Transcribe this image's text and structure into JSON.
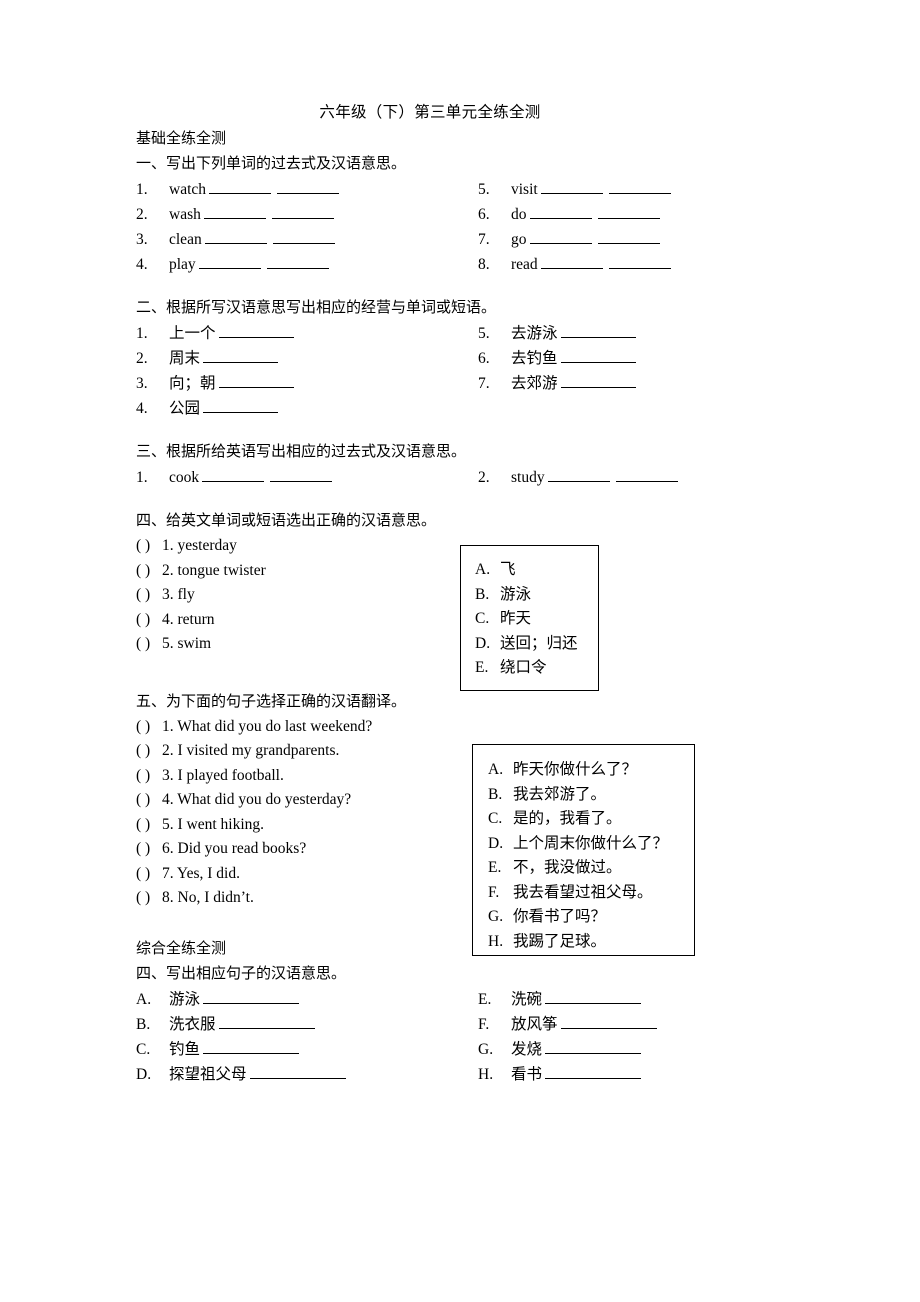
{
  "document": {
    "title": "六年级（下）第三单元全练全测",
    "part_one_label": "基础全练全测",
    "part_two_label": "综合全练全测"
  },
  "section_1": {
    "heading": "一、写出下列单词的过去式及汉语意思。",
    "left": [
      {
        "num": "1.",
        "word": "watch"
      },
      {
        "num": "2.",
        "word": "wash"
      },
      {
        "num": "3.",
        "word": "clean"
      },
      {
        "num": "4.",
        "word": "play"
      }
    ],
    "right": [
      {
        "num": "5.",
        "word": "visit"
      },
      {
        "num": "6.",
        "word": "do"
      },
      {
        "num": "7.",
        "word": "go"
      },
      {
        "num": "8.",
        "word": "read"
      }
    ]
  },
  "section_2": {
    "heading": "二、根据所写汉语意思写出相应的经营与单词或短语。",
    "left": [
      {
        "num": "1.",
        "word": "上一个"
      },
      {
        "num": "2.",
        "word": "周末"
      },
      {
        "num": "3.",
        "word": "向；朝"
      },
      {
        "num": "4.",
        "word": "公园"
      }
    ],
    "right": [
      {
        "num": "5.",
        "word": "去游泳"
      },
      {
        "num": "6.",
        "word": "去钓鱼"
      },
      {
        "num": "7.",
        "word": "去郊游"
      }
    ]
  },
  "section_3": {
    "heading": "三、根据所给英语写出相应的过去式及汉语意思。",
    "left": [
      {
        "num": "1.",
        "word": "cook"
      }
    ],
    "right": [
      {
        "num": "2.",
        "word": "study"
      }
    ]
  },
  "section_4": {
    "heading": "四、给英文单词或短语选出正确的汉语意思。",
    "items": [
      {
        "paren": "(    )",
        "text": "1. yesterday"
      },
      {
        "paren": "(    )",
        "text": "2. tongue twister"
      },
      {
        "paren": "(    )",
        "text": "3. fly"
      },
      {
        "paren": "(    )",
        "text": "4. return"
      },
      {
        "paren": "(    )",
        "text": "5. swim"
      }
    ],
    "options": [
      {
        "letter": "A.",
        "text": "飞"
      },
      {
        "letter": "B.",
        "text": "游泳"
      },
      {
        "letter": "C.",
        "text": "昨天"
      },
      {
        "letter": "D.",
        "text": "送回；归还"
      },
      {
        "letter": "E.",
        "text": "绕口令"
      }
    ]
  },
  "section_5": {
    "heading": "五、为下面的句子选择正确的汉语翻译。",
    "items": [
      {
        "paren": "(    )",
        "text": "1. What did you do last weekend?"
      },
      {
        "paren": "(    )",
        "text": "2. I visited my grandparents."
      },
      {
        "paren": "(    )",
        "text": "3. I played football."
      },
      {
        "paren": "(    )",
        "text": "4. What did you do yesterday?"
      },
      {
        "paren": "(    )",
        "text": "5. I went hiking."
      },
      {
        "paren": "(    )",
        "text": "6. Did you read books?"
      },
      {
        "paren": "(    )",
        "text": "7. Yes, I did."
      },
      {
        "paren": "(    )",
        "text": "8. No, I didn’t."
      }
    ],
    "options": [
      {
        "letter": "A.",
        "text": "昨天你做什么了？"
      },
      {
        "letter": "B.",
        "text": "我去郊游了。"
      },
      {
        "letter": "C.",
        "text": "是的，我看了。"
      },
      {
        "letter": "D.",
        "text": "上个周末你做什么了？"
      },
      {
        "letter": "E.",
        "text": "不，我没做过。"
      },
      {
        "letter": "F.",
        "text": "我去看望过祖父母。"
      },
      {
        "letter": "G.",
        "text": "你看书了吗？"
      },
      {
        "letter": "H.",
        "text": "我踢了足球。"
      }
    ]
  },
  "section_6": {
    "heading": "四、写出相应句子的汉语意思。",
    "left": [
      {
        "num": "A.",
        "word": "游泳"
      },
      {
        "num": "B.",
        "word": "洗衣服"
      },
      {
        "num": "C.",
        "word": "钓鱼"
      },
      {
        "num": "D.",
        "word": "探望祖父母"
      }
    ],
    "right": [
      {
        "num": "E.",
        "word": "洗碗"
      },
      {
        "num": "F.",
        "word": "放风筝"
      },
      {
        "num": "G.",
        "word": "发烧"
      },
      {
        "num": "H.",
        "word": "看书"
      }
    ]
  }
}
